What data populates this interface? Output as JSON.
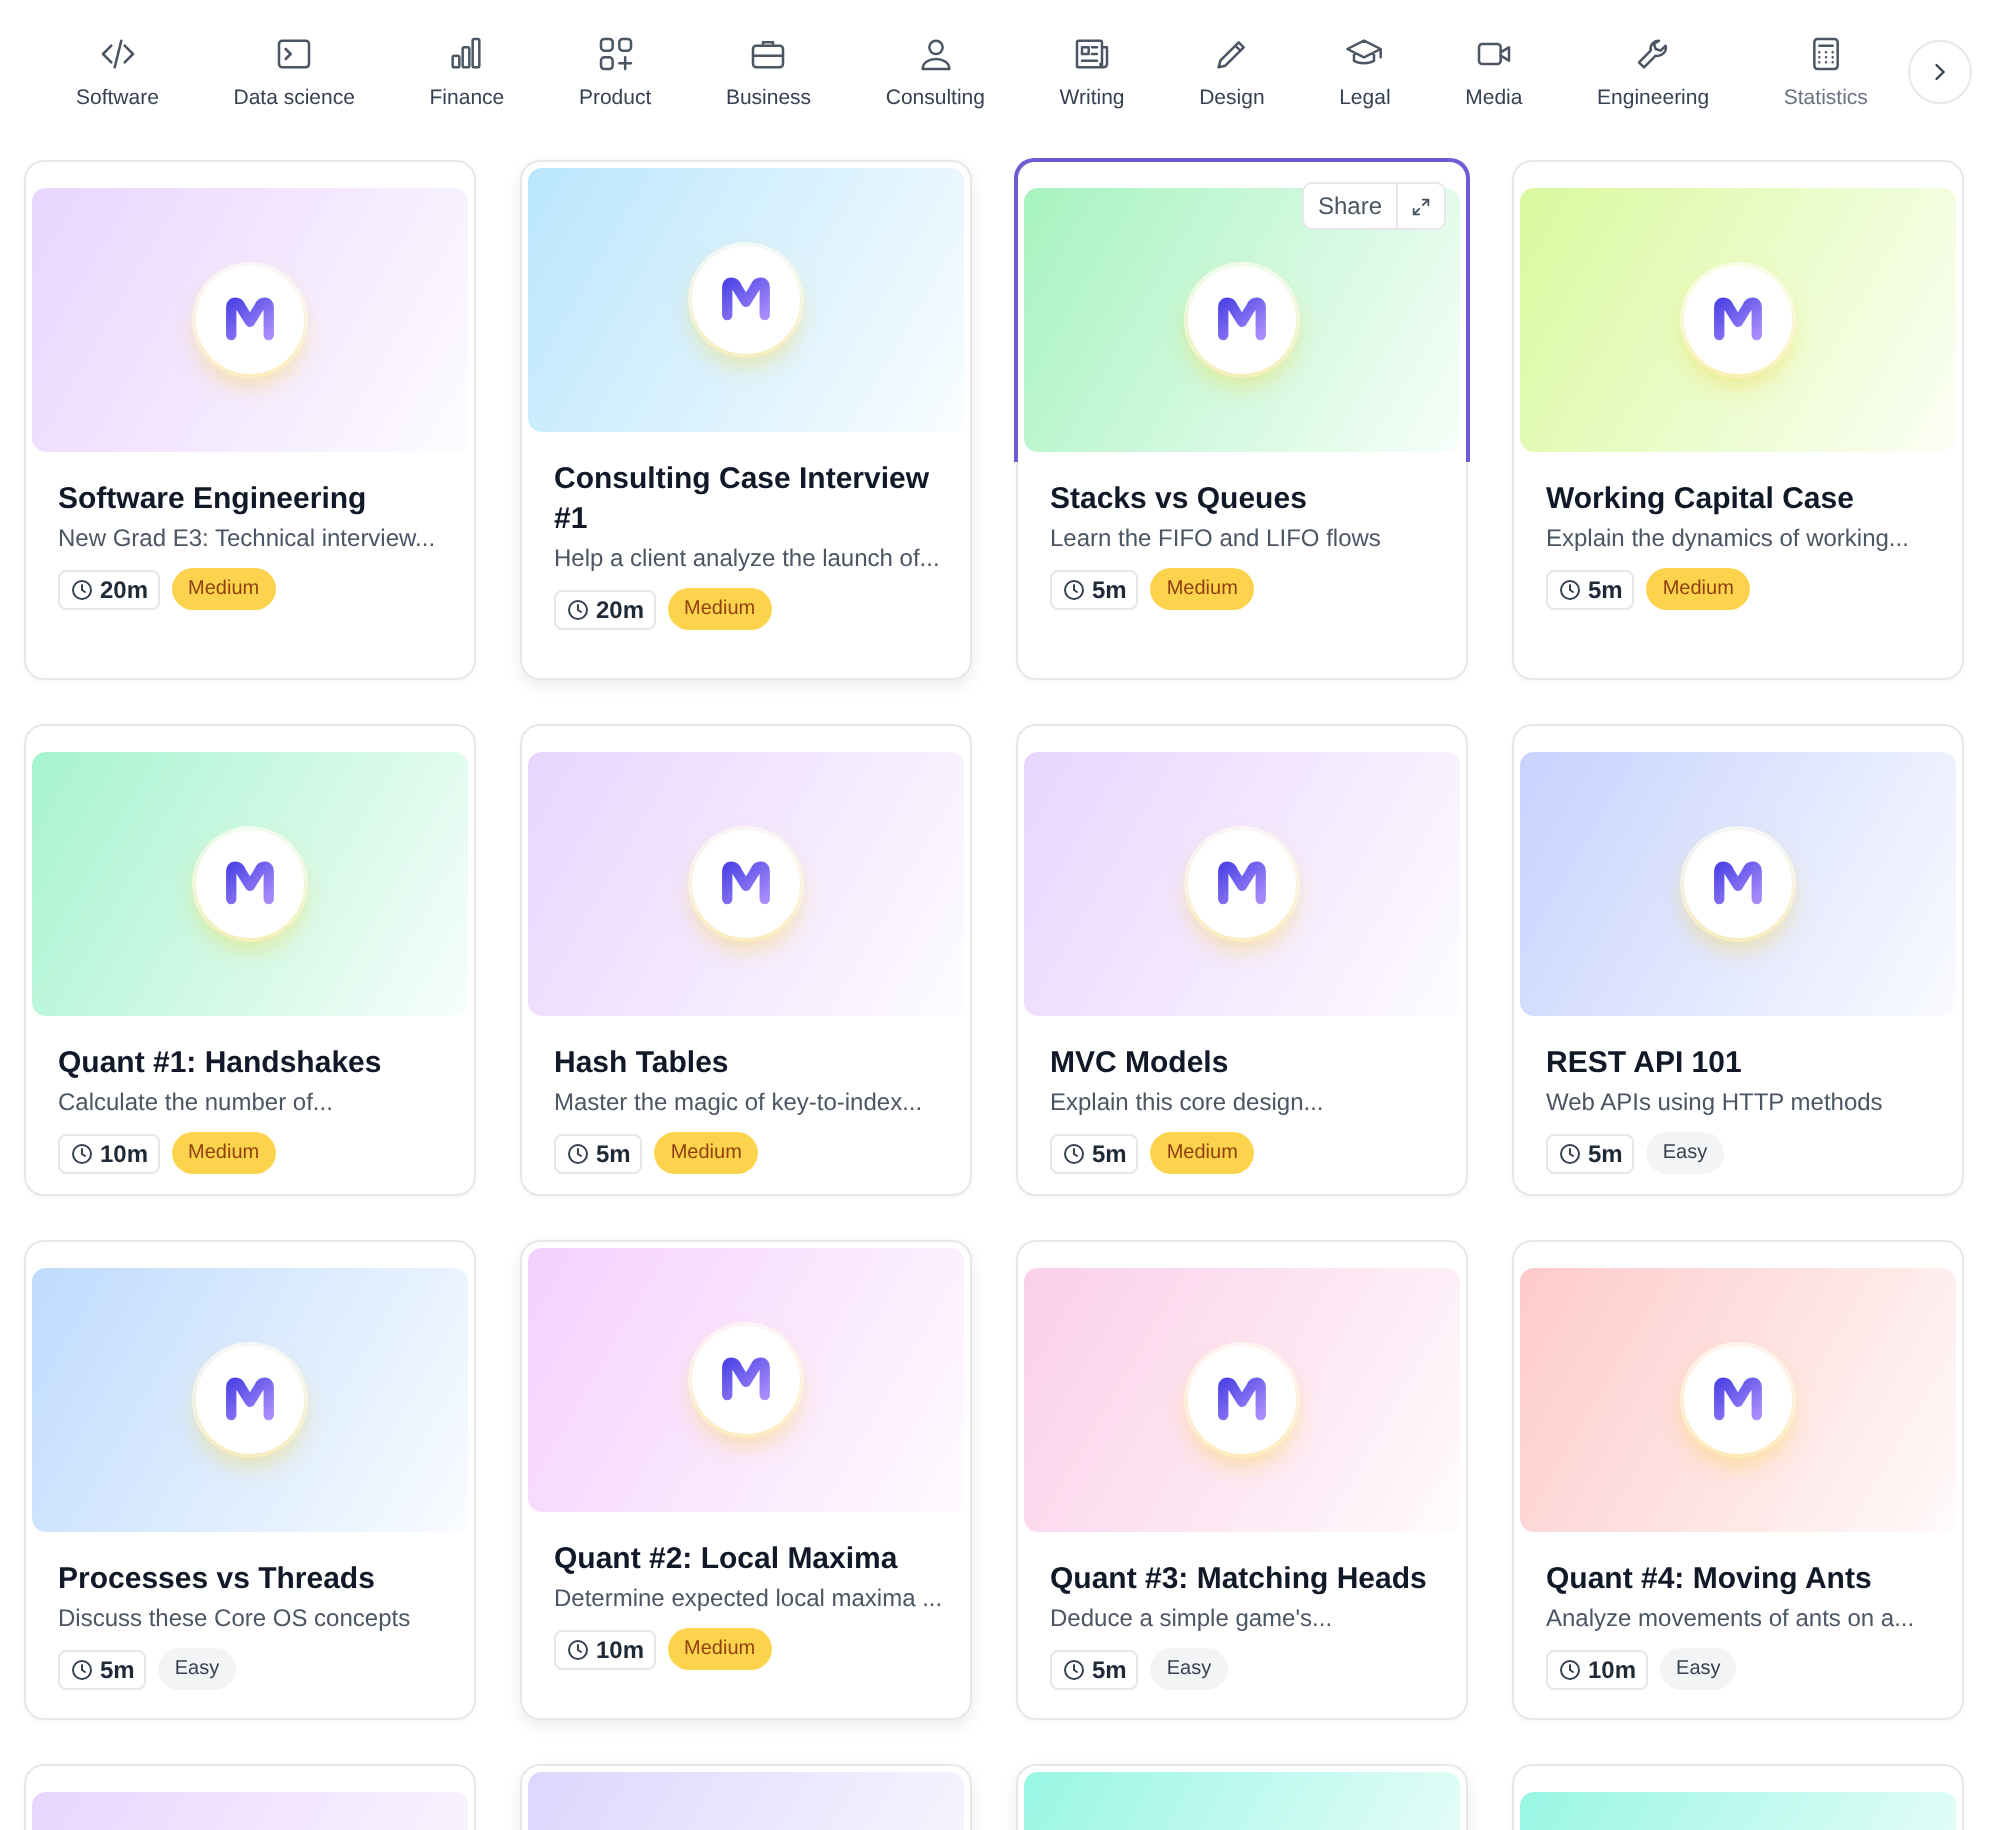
{
  "categories": [
    {
      "label": "Software"
    },
    {
      "label": "Data science"
    },
    {
      "label": "Finance"
    },
    {
      "label": "Product"
    },
    {
      "label": "Business"
    },
    {
      "label": "Consulting"
    },
    {
      "label": "Writing"
    },
    {
      "label": "Design"
    },
    {
      "label": "Legal"
    },
    {
      "label": "Media"
    },
    {
      "label": "Engineering"
    },
    {
      "label": "Statistics"
    }
  ],
  "cards": [
    {
      "title": "Software Engineering",
      "description": "New Grad E3: Technical interview...",
      "duration": "20m",
      "difficulty": {
        "label": "Medium",
        "kind": "medium"
      },
      "color": "#e9d5ff",
      "raised": false,
      "hovered": false
    },
    {
      "title": "Consulting Case Interview #1",
      "description": "Help a client analyze the launch of...",
      "duration": "20m",
      "difficulty": {
        "label": "Medium",
        "kind": "medium"
      },
      "color": "#bae6fd",
      "raised": true,
      "hovered": false
    },
    {
      "title": "Stacks vs Queues",
      "description": "Learn the FIFO and LIFO flows",
      "duration": "5m",
      "difficulty": {
        "label": "Medium",
        "kind": "medium"
      },
      "color": "#a7f3c0",
      "raised": false,
      "hovered": true,
      "share": "Share"
    },
    {
      "title": "Working Capital Case",
      "description": "Explain the dynamics of working...",
      "duration": "5m",
      "difficulty": {
        "label": "Medium",
        "kind": "medium"
      },
      "color": "#d9f99d",
      "raised": false,
      "hovered": false
    },
    {
      "title": "Quant #1: Handshakes",
      "description": "Calculate the number of...",
      "duration": "10m",
      "difficulty": {
        "label": "Medium",
        "kind": "medium"
      },
      "color": "#a7f3d0",
      "raised": false,
      "hovered": false
    },
    {
      "title": "Hash Tables",
      "description": "Master the magic of key-to-index...",
      "duration": "5m",
      "difficulty": {
        "label": "Medium",
        "kind": "medium"
      },
      "color": "#e9d5ff",
      "raised": false,
      "hovered": false
    },
    {
      "title": "MVC Models",
      "description": "Explain this core design...",
      "duration": "5m",
      "difficulty": {
        "label": "Medium",
        "kind": "medium"
      },
      "color": "#e9d5ff",
      "raised": false,
      "hovered": false
    },
    {
      "title": "REST API 101",
      "description": "Web APIs using HTTP methods",
      "duration": "5m",
      "difficulty": {
        "label": "Easy",
        "kind": "easy"
      },
      "color": "#c7d2fe",
      "raised": false,
      "hovered": false
    },
    {
      "title": "Processes vs Threads",
      "description": "Discuss these Core OS concepts",
      "duration": "5m",
      "difficulty": {
        "label": "Easy",
        "kind": "easy"
      },
      "color": "#bfdbfe",
      "raised": false,
      "hovered": false
    },
    {
      "title": "Quant #2: Local Maxima",
      "description": "Determine expected local maxima ...",
      "duration": "10m",
      "difficulty": {
        "label": "Medium",
        "kind": "medium"
      },
      "color": "#f5d0fe",
      "raised": true,
      "hovered": false
    },
    {
      "title": "Quant #3: Matching Heads",
      "description": "Deduce a simple game's...",
      "duration": "5m",
      "difficulty": {
        "label": "Easy",
        "kind": "easy"
      },
      "color": "#fbcfe8",
      "raised": false,
      "hovered": false
    },
    {
      "title": "Quant #4: Moving Ants",
      "description": "Analyze movements of ants on a...",
      "duration": "10m",
      "difficulty": {
        "label": "Easy",
        "kind": "easy"
      },
      "color": "#fecaca",
      "raised": false,
      "hovered": false
    },
    {
      "color": "#e9d5ff",
      "raised": false,
      "hovered": false
    },
    {
      "color": "#ddd6fe",
      "raised": true,
      "hovered": false
    },
    {
      "color": "#99f6e4",
      "raised": true,
      "hovered": false
    },
    {
      "color": "#99f6e4",
      "raised": false,
      "hovered": false
    }
  ]
}
